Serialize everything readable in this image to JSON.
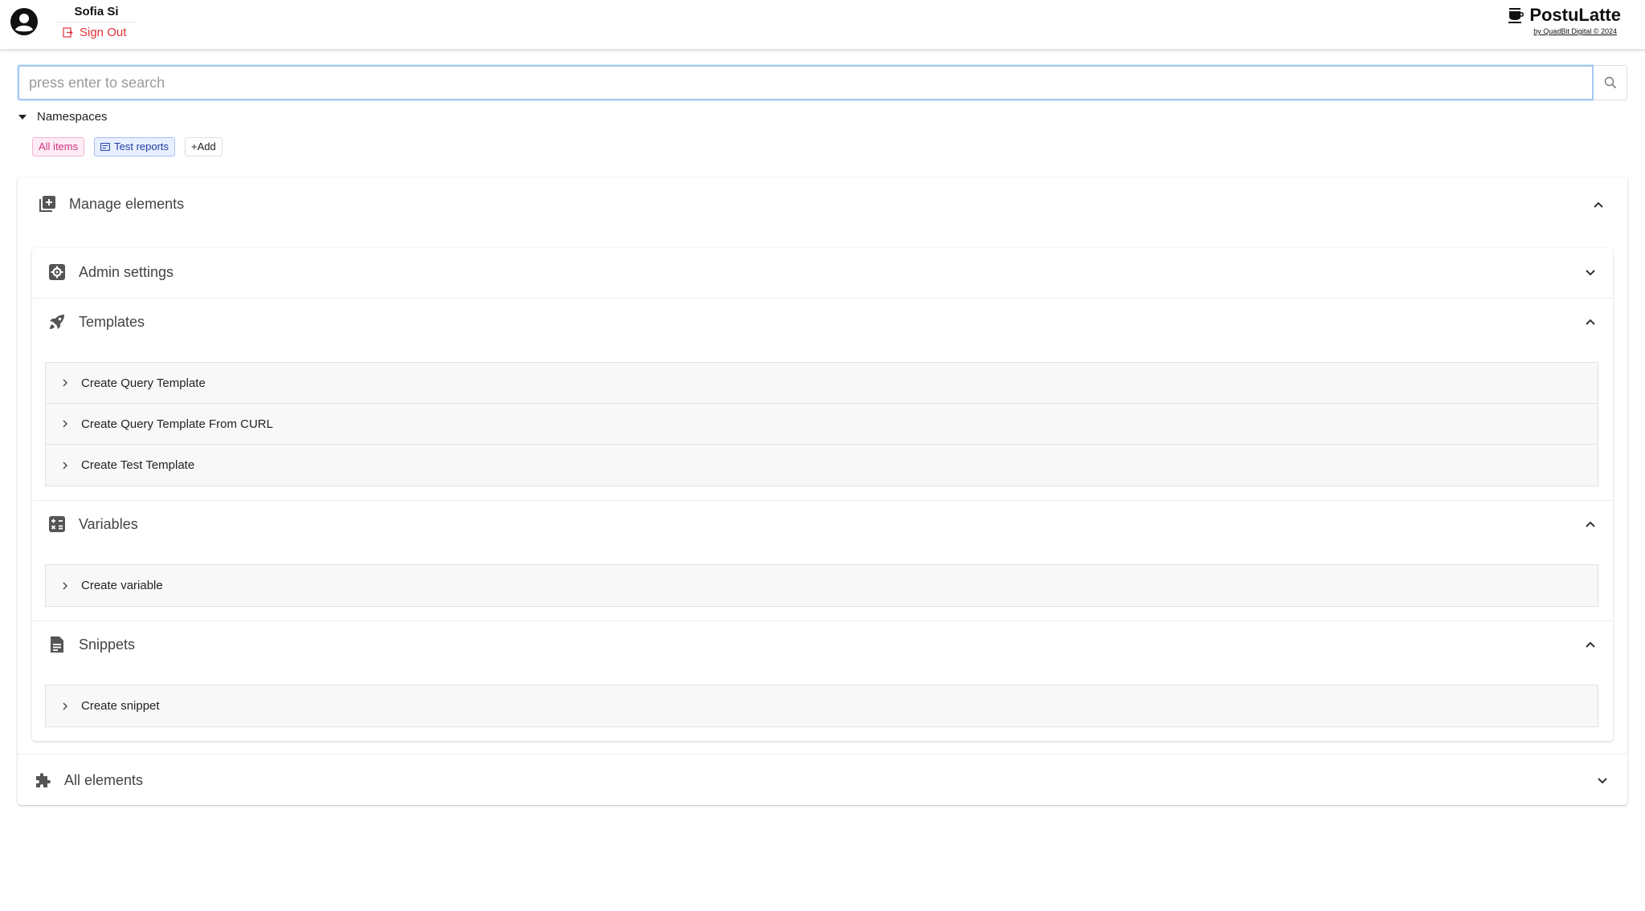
{
  "user": {
    "name": "Sofia Si",
    "sign_out": "Sign Out"
  },
  "brand": {
    "name": "PostuLatte",
    "subtitle": "by QuadBit Digital © 2024"
  },
  "search": {
    "placeholder": "press enter to search",
    "value": ""
  },
  "namespaces": {
    "label": "Namespaces",
    "tags": [
      {
        "label": "All items"
      },
      {
        "label": "Test reports"
      },
      {
        "label": "+Add"
      }
    ]
  },
  "manage": {
    "title": "Manage elements",
    "sections": [
      {
        "title": "Admin settings",
        "items": []
      },
      {
        "title": "Templates",
        "items": [
          "Create Query Template",
          "Create Query Template From CURL",
          "Create Test Template"
        ]
      },
      {
        "title": "Variables",
        "items": [
          "Create variable"
        ]
      },
      {
        "title": "Snippets",
        "items": [
          "Create snippet"
        ]
      }
    ]
  },
  "all_elements": {
    "title": "All elements"
  },
  "colors": {
    "accent_red": "#e0303a",
    "tag_pink": "#d63384",
    "tag_blue": "#1f3fa6",
    "focus_blue": "#a6c8f0"
  }
}
